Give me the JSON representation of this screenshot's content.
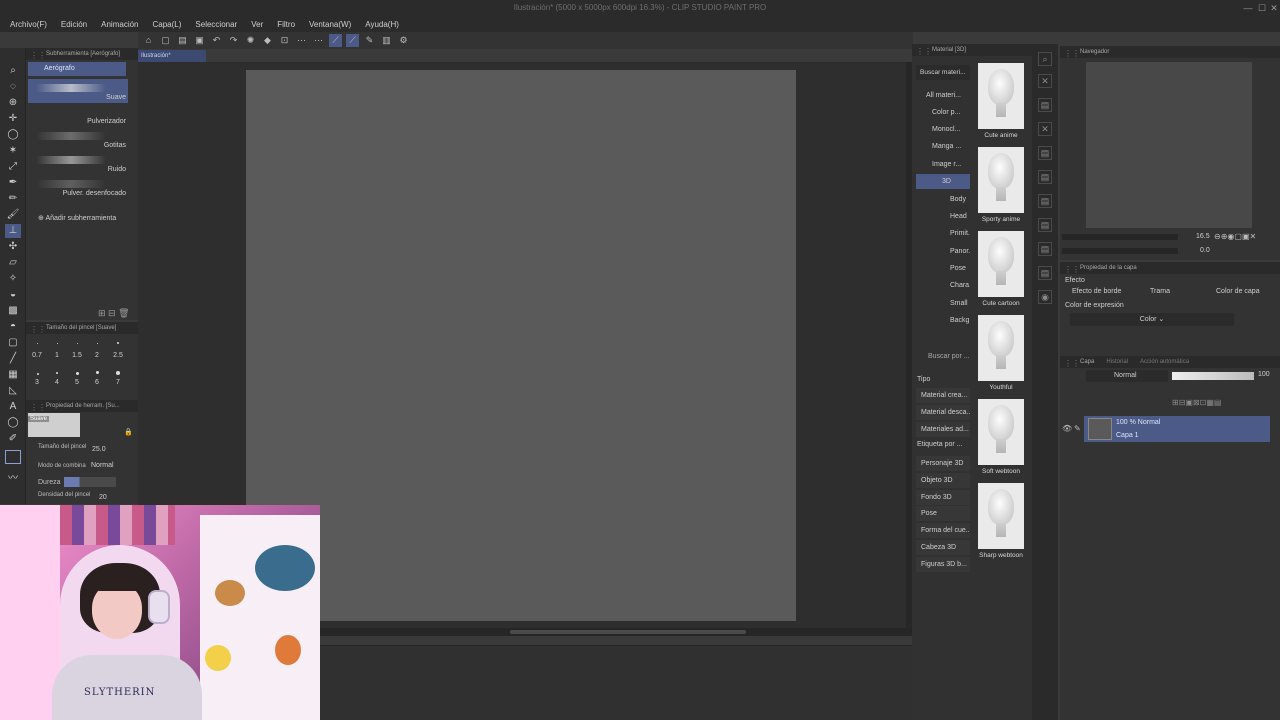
{
  "window": {
    "title": "Ilustración* (5000 x 5000px 600dpi 16.3%) - CLIP STUDIO PAINT PRO",
    "minimize": "—",
    "maximize": "☐",
    "close": "✕"
  },
  "menu": [
    "Archivo(F)",
    "Edición",
    "Animación",
    "Capa(L)",
    "Seleccionar",
    "Ver",
    "Filtro",
    "Ventana(W)",
    "Ayuda(H)"
  ],
  "subtool": {
    "panel_title": "Subherramienta [Aerógrafo]",
    "group": "Aerógrafo",
    "brushes": [
      "Suave",
      "Pulverizador",
      "Gotitas",
      "Ruido",
      "Pulver. desenfocado"
    ],
    "add": "Añadir subherramienta"
  },
  "brush_size": {
    "panel_title": "Tamaño del pincel [Suave]",
    "row1": [
      "0.7",
      "1",
      "1.5",
      "2",
      "2.5"
    ],
    "row2": [
      "3",
      "4",
      "5",
      "6",
      "7"
    ]
  },
  "tool_property": {
    "panel_title": "Propiedad de herram. [Su...",
    "preset": "Suave",
    "size_label": "Tamaño del pincel",
    "size_value": "25.0",
    "blend_label": "Modo de combina",
    "blend_value": "Normal",
    "hardness_label": "Dureza",
    "density_label": "Densidad del pincel",
    "density_value": "20"
  },
  "canvas": {
    "tab_label": "Ilustración*"
  },
  "material": {
    "panel_title": "Material [3D]",
    "search_button": "Buscar materi...",
    "tree": [
      "All materi...",
      "Color p...",
      "Monocl...",
      "Manga ...",
      "Image r...",
      "3D",
      "Body",
      "Head",
      "Primit...",
      "Panor...",
      "Pose",
      "Chara...",
      "Small ...",
      "Backg..."
    ],
    "search_tag": "Buscar por ...",
    "type_label": "Tipo",
    "types": [
      "Material crea...",
      "Material desca...",
      "Materiales ad..."
    ],
    "tag_label": "Etiqueta por ...",
    "tags": [
      "Personaje 3D",
      "Objeto 3D",
      "Fondo 3D",
      "Pose",
      "Forma del cue...",
      "Cabeza 3D",
      "Figuras 3D b..."
    ],
    "items": [
      "Cute anime",
      "Sporty anime",
      "Cute cartoon",
      "Youthful",
      "Soft webtoon",
      "Sharp webtoon"
    ]
  },
  "navigator": {
    "panel_title": "Navegador",
    "zoom": "16.5",
    "rotation": "0.0"
  },
  "layer_property": {
    "panel_title": "Propiedad de la capa",
    "effect_label": "Efecto",
    "border_effect": "Efecto de borde",
    "tone": "Trama",
    "layer_color": "Color de capa",
    "expression_label": "Color de expresión",
    "expression_value": "Color"
  },
  "layer": {
    "panel_title": "Capa",
    "tab_history": "Historial",
    "tab_auto": "Acción automática",
    "blend_mode": "Normal",
    "opacity": "100",
    "row_mode": "100 % Normal",
    "row_name": "Capa 1"
  },
  "webcam": {
    "shirt_text": "SLYTHERIN"
  },
  "colors": {
    "accent": "#4b5a86",
    "canvas": "#5a5a5a",
    "panel": "#333333"
  }
}
